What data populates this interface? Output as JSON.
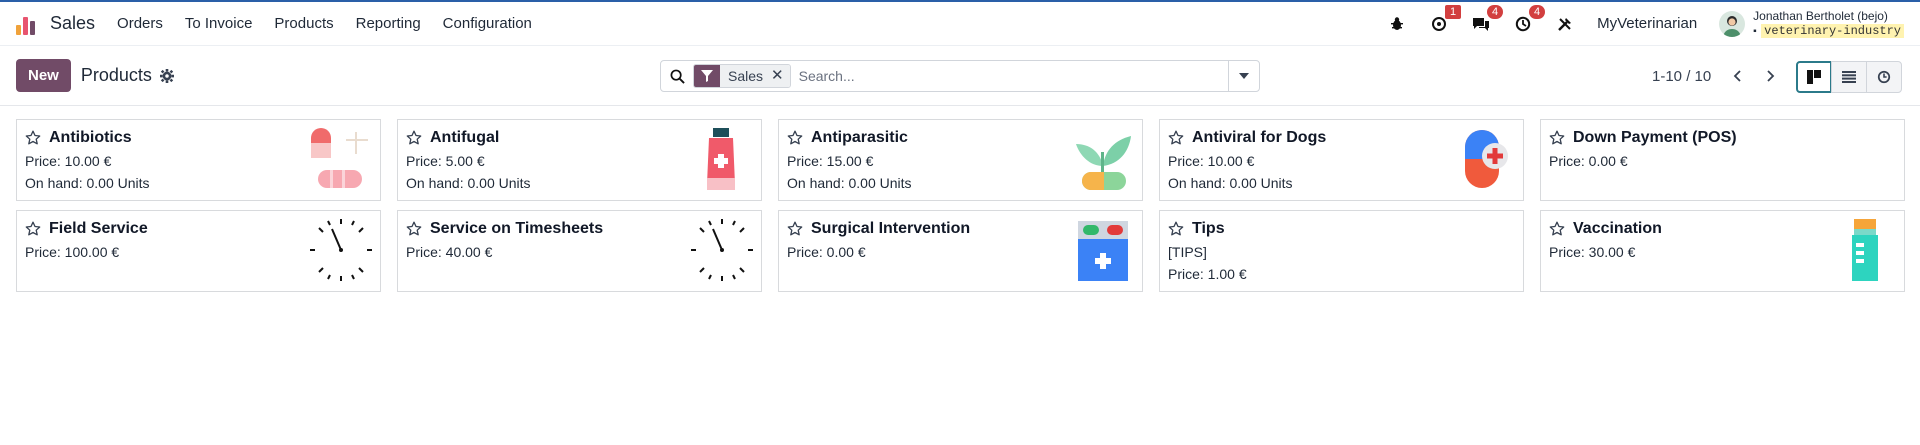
{
  "topbar": {
    "app_name": "Sales",
    "nav": [
      "Orders",
      "To Invoice",
      "Products",
      "Reporting",
      "Configuration"
    ],
    "system_icons": [
      {
        "name": "bug-icon",
        "badge": ""
      },
      {
        "name": "activity-icon",
        "badge": "1"
      },
      {
        "name": "chat-icon",
        "badge": "4"
      },
      {
        "name": "clock-icon",
        "badge": "4"
      },
      {
        "name": "tools-icon",
        "badge": ""
      }
    ],
    "company": "MyVeterinarian",
    "user_name": "Jonathan Bertholet (bejo)",
    "database": "veterinary-industry"
  },
  "control": {
    "new_label": "New",
    "title": "Products",
    "facet_label": "Sales",
    "search_placeholder": "Search...",
    "pager": "1-10 / 10"
  },
  "products": [
    {
      "name": "Antibiotics",
      "lines": [
        "Price: 10.00 €",
        "On hand: 0.00 Units"
      ],
      "image": "pills"
    },
    {
      "name": "Antifugal",
      "lines": [
        "Price: 5.00 €",
        "On hand: 0.00 Units"
      ],
      "image": "tube"
    },
    {
      "name": "Antiparasitic",
      "lines": [
        "Price: 15.00 €",
        "On hand: 0.00 Units"
      ],
      "image": "plant-capsule"
    },
    {
      "name": "Antiviral for Dogs",
      "lines": [
        "Price: 10.00 €",
        "On hand: 0.00 Units"
      ],
      "image": "capsule-cross"
    },
    {
      "name": "Down Payment (POS)",
      "lines": [
        "Price: 0.00 €"
      ],
      "image": ""
    },
    {
      "name": "Field Service",
      "lines": [
        "Price: 100.00 €"
      ],
      "image": "clock"
    },
    {
      "name": "Service on Timesheets",
      "lines": [
        "Price: 40.00 €"
      ],
      "image": "clock"
    },
    {
      "name": "Surgical Intervention",
      "lines": [
        "Price: 0.00 €"
      ],
      "image": "med-box"
    },
    {
      "name": "Tips",
      "lines": [
        "[TIPS]",
        "Price: 1.00 €"
      ],
      "image": ""
    },
    {
      "name": "Vaccination",
      "lines": [
        "Price: 30.00 €"
      ],
      "image": "vial"
    }
  ],
  "colors": {
    "brand": "#714b67",
    "badge": "#d23f3f",
    "active_view": "#2b7a8a"
  }
}
